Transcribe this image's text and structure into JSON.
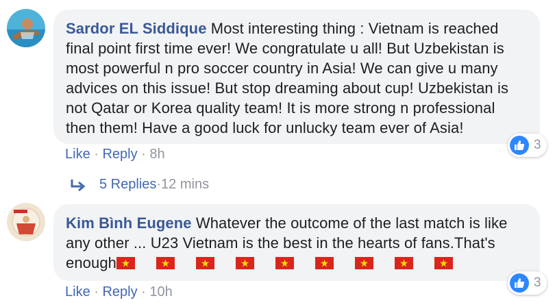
{
  "comments": [
    {
      "author": "Sardor EL Siddique",
      "text": "Most interesting thing : Vietnam is reached final point first time ever! We congratulate u all! But Uzbekistan is most powerful n pro soccer country in Asia! We can give u many advices on this issue! But stop dreaming about cup! Uzbekistan is not Qatar or Korea quality team! It is more strong n professional then them! Have a good luck for unlucky team ever of Asia!",
      "like_label": "Like",
      "dot": " · ",
      "reply_label": "Reply",
      "time": "8h",
      "reaction_count": "3",
      "replies": {
        "count": "5 Replies",
        "dot": " · ",
        "time": "12 mins"
      }
    },
    {
      "author": "Kim Bình Eugene",
      "text": "Whatever the outcome of the last match is like any other ... U23 Vietnam is the best in the hearts of fans.That's enough",
      "emoji": [
        "vietnam-flag",
        "vietnam-flag",
        "vietnam-flag",
        "vietnam-flag",
        "vietnam-flag",
        "vietnam-flag",
        "vietnam-flag",
        "vietnam-flag",
        "vietnam-flag"
      ],
      "like_label": "Like",
      "dot": " · ",
      "reply_label": "Reply",
      "time": "10h",
      "reaction_count": "3"
    }
  ],
  "colors": {
    "author": "#385898",
    "link": "#4267b2",
    "meta": "#90949c",
    "bubble": "#f2f3f5",
    "like_icon": "#2d88ff"
  }
}
